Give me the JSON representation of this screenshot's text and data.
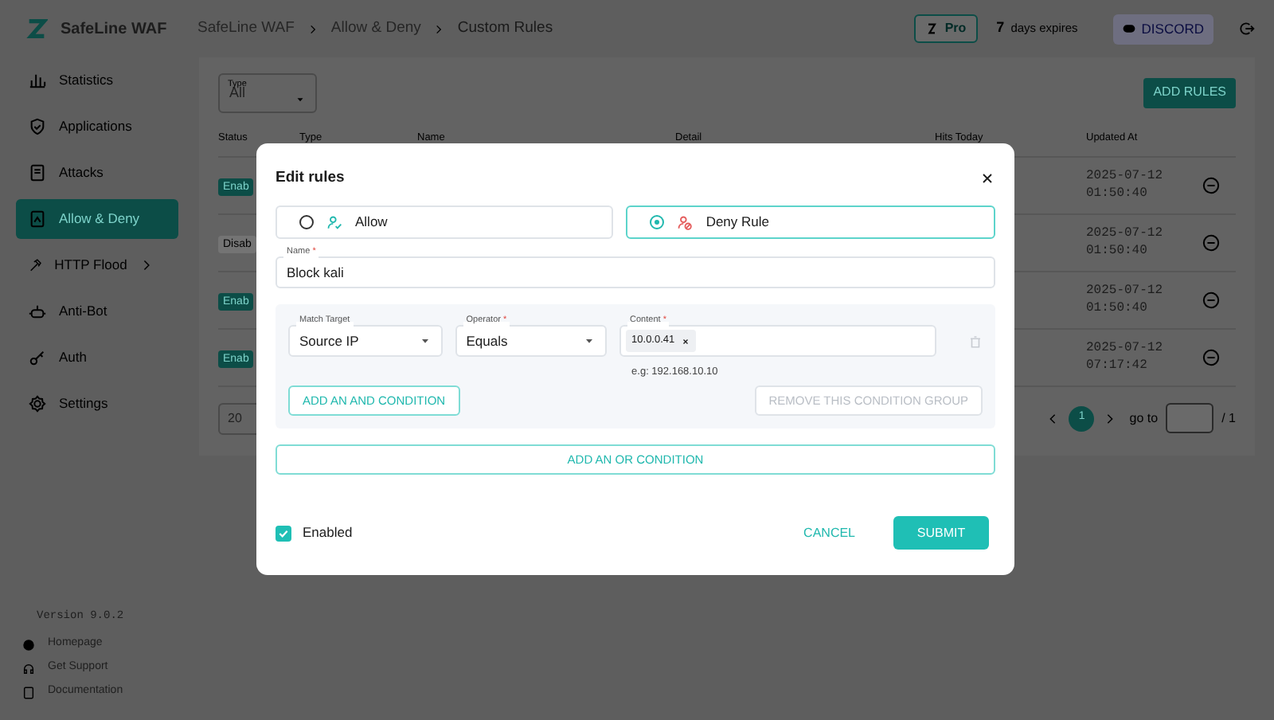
{
  "app": {
    "name": "SafeLine WAF"
  },
  "sidebar": {
    "items": [
      {
        "label": "Statistics",
        "selected": false,
        "has_submenu": false
      },
      {
        "label": "Applications",
        "selected": false,
        "has_submenu": false
      },
      {
        "label": "Attacks",
        "selected": false,
        "has_submenu": false
      },
      {
        "label": "Allow & Deny",
        "selected": true,
        "has_submenu": false
      },
      {
        "label": "HTTP Flood",
        "selected": false,
        "has_submenu": true
      },
      {
        "label": "Anti-Bot",
        "selected": false,
        "has_submenu": false
      },
      {
        "label": "Auth",
        "selected": false,
        "has_submenu": false
      },
      {
        "label": "Settings",
        "selected": false,
        "has_submenu": false
      }
    ],
    "version": "Version 9.0.2",
    "links": [
      "Homepage",
      "Get Support",
      "Documentation"
    ]
  },
  "header": {
    "breadcrumbs": [
      "SafeLine WAF",
      "Allow & Deny",
      "Custom Rules"
    ],
    "plan": "Pro",
    "days": "7",
    "days_label": "days expires",
    "discord": "DISCORD"
  },
  "filter": {
    "label": "Type",
    "value": "All"
  },
  "add_button": "ADD RULES",
  "table": {
    "columns": [
      "Status",
      "Type",
      "Name",
      "Detail",
      "Hits Today",
      "Updated At"
    ],
    "rows": [
      {
        "status": "Enab",
        "enabled": true,
        "updated_at": "2025-07-12 01:50:40"
      },
      {
        "status": "Disab",
        "enabled": false,
        "updated_at": "2025-07-12 01:50:40"
      },
      {
        "status": "Enab",
        "enabled": true,
        "updated_at": "2025-07-12 01:50:40"
      },
      {
        "status": "Enab",
        "enabled": true,
        "updated_at": "2025-07-12 07:17:42"
      }
    ]
  },
  "pagination": {
    "page_size": "20",
    "pages": [
      {
        "label": "1",
        "selected": true
      }
    ],
    "goto_label": "go to",
    "total": "/ 1"
  },
  "dialog": {
    "title": "Edit rules",
    "rule_types": [
      {
        "label": "Allow",
        "kind": "allow",
        "selected": false
      },
      {
        "label": "Deny Rule",
        "kind": "deny",
        "selected": true
      }
    ],
    "name": {
      "label": "Name",
      "mark": "*",
      "value": "Block kali"
    },
    "conditions": [
      {
        "label": "Match Target",
        "kind": "select",
        "value": "Source IP"
      },
      {
        "label": "Operator",
        "mark": "*",
        "kind": "select",
        "value": "Equals"
      },
      {
        "label": "Content",
        "mark": "*",
        "kind": "tags",
        "tags": [
          "10.0.0.41"
        ],
        "hint": "e.g: 192.168.10.10"
      }
    ],
    "add_and": "ADD AN AND CONDITION",
    "remove_group": {
      "label": "REMOVE THIS CONDITION GROUP",
      "disabled": true
    },
    "add_or": "ADD AN OR CONDITION",
    "enabled": {
      "label": "Enabled",
      "checked": true
    },
    "cancel": "CANCEL",
    "submit": "SUBMIT"
  }
}
